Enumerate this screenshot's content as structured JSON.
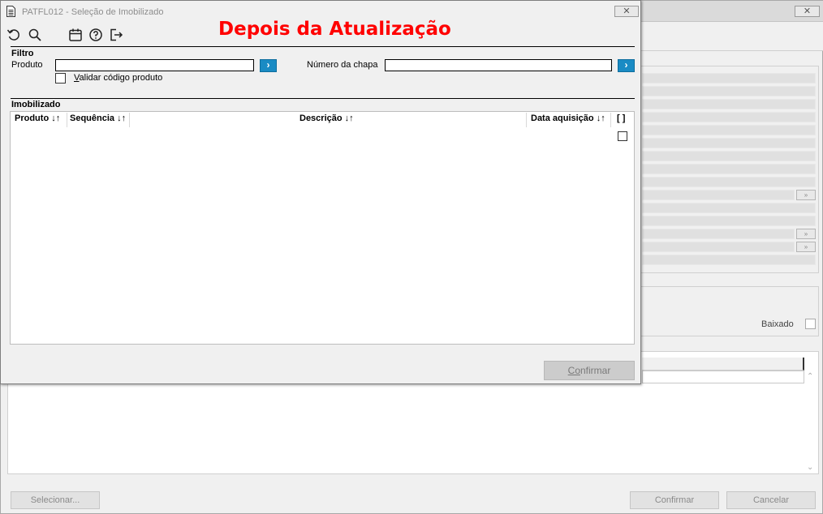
{
  "background_window": {
    "close_label": "✕",
    "baixado_label": "Baixado",
    "buttons": {
      "selecionar": "Selecionar...",
      "confirmar": "Confirmar",
      "cancelar": "Cancelar"
    }
  },
  "dialog": {
    "title": "PATFL012 - Seleção de Imobilizado",
    "close_label": "✕",
    "annotation": "Depois da Atualização",
    "toolbar": {
      "icons": [
        "undo-icon",
        "search-icon",
        "calendar-icon",
        "help-icon",
        "exit-icon"
      ]
    },
    "filtro": {
      "title": "Filtro",
      "produto_label": "Produto",
      "produto_value": "",
      "numero_chapa_label": "Número da chapa",
      "numero_chapa_value": "",
      "go_label": "›",
      "validar_label": "Validar código produto",
      "validar_checked": false
    },
    "imobilizado": {
      "title": "Imobilizado",
      "columns": [
        "Produto ↓↑",
        "Sequência ↓↑",
        "Descrição ↓↑",
        "Data aquisição ↓↑",
        "[ ]"
      ],
      "rows": []
    },
    "confirm_label": "Confirmar"
  },
  "colors": {
    "annotation": "#ff0000",
    "go_button": "#1a8bc4"
  }
}
